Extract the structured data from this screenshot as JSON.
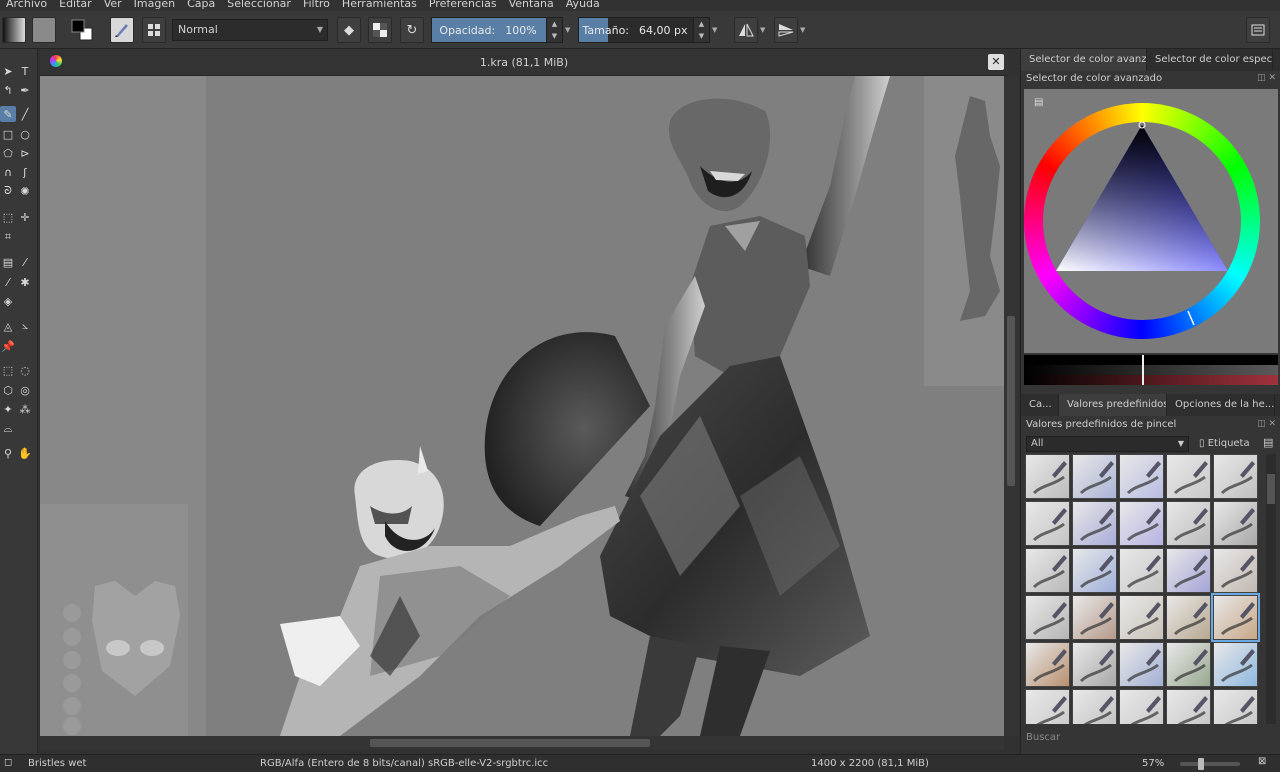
{
  "menubar": {
    "items": [
      "Archivo",
      "Editar",
      "Ver",
      "Imagen",
      "Capa",
      "Seleccionar",
      "Filtro",
      "Herramientas",
      "Preferencias",
      "Ventana",
      "Ayuda"
    ]
  },
  "toolbar": {
    "blend_mode": "Normal",
    "opacity_label": "Opacidad:",
    "opacity_value": "100%",
    "opacity_fraction": 1.0,
    "size_label": "Tamaño:",
    "size_value": "64,00 px",
    "size_fraction": 0.22
  },
  "document": {
    "tab_title": "1.kra (81,1 MiB)"
  },
  "dock": {
    "color_tabs": [
      "Selector de color avanz...",
      "Selector de color especif..."
    ],
    "color_title": "Selector de color avanzado",
    "preset_tabs": [
      "Ca...",
      "Valores predefinidos...",
      "Opciones de la he..."
    ],
    "preset_title": "Valores predefinidos de pincel",
    "preset_filter": "All",
    "preset_tag": "Etiqueta",
    "search_label": "Buscar"
  },
  "statusbar": {
    "brush_name": "Bristles wet",
    "color_profile": "RGB/Alfa (Entero de 8 bits/canal)  sRGB-elle-V2-srgbtrc.icc",
    "image_size": "1400 x 2200 (81,1 MiB)",
    "zoom": "57%"
  },
  "colors": {
    "accent": "#5a7fa7",
    "canvas": "#7e7e7e",
    "panel": "#353535"
  }
}
